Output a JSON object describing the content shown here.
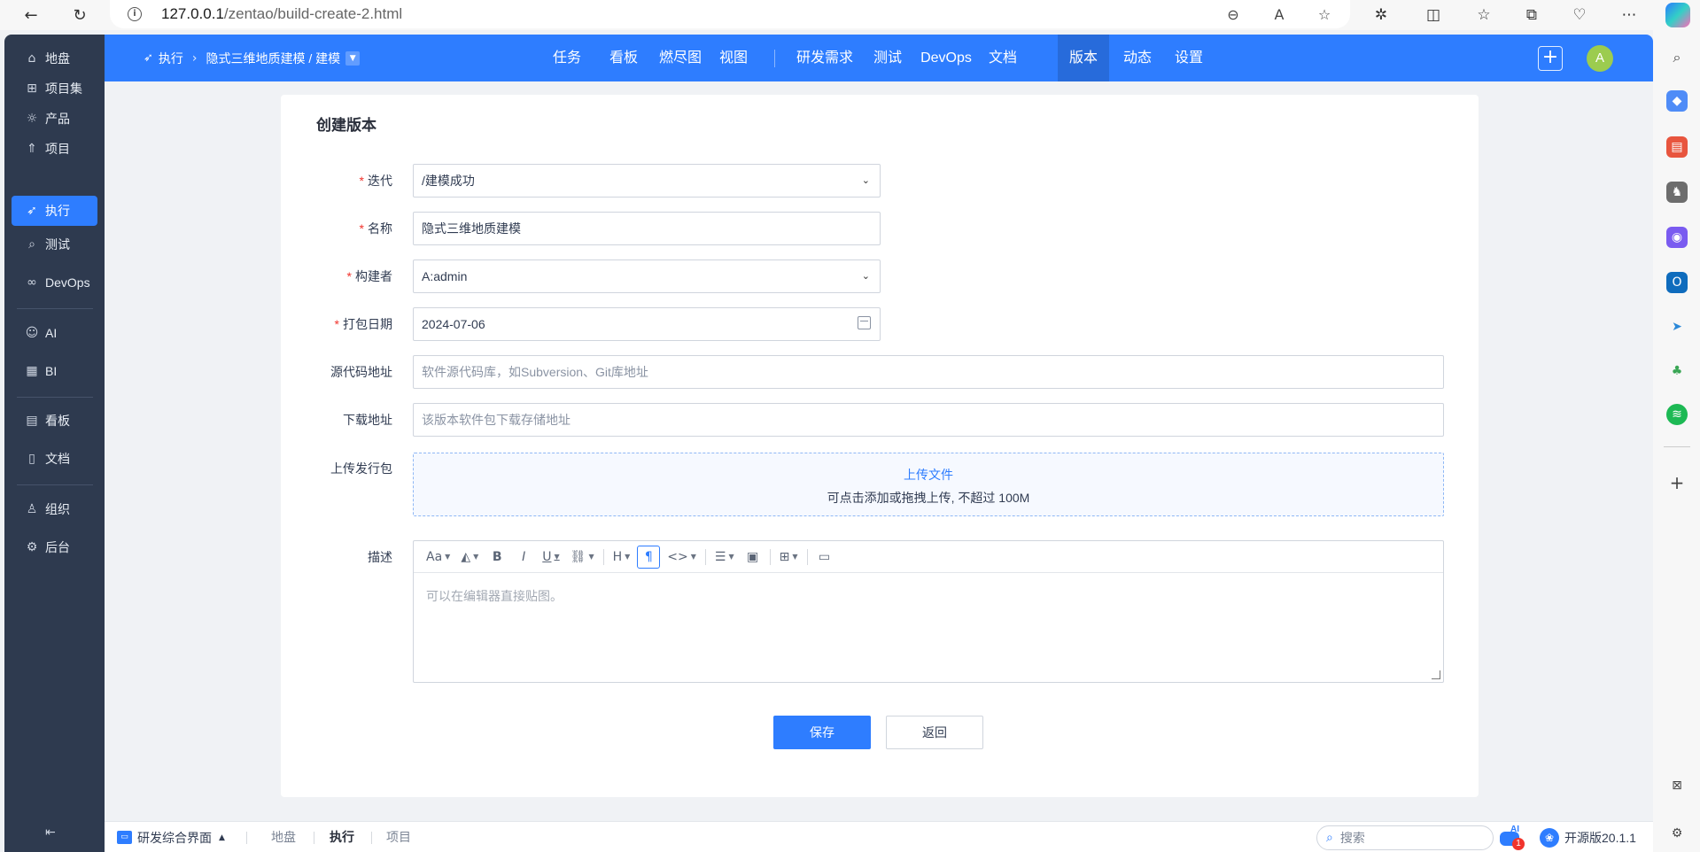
{
  "browser": {
    "url_host": "127.0.0.1",
    "url_path": "/zentao/build-create-2.html"
  },
  "left_nav": {
    "items": [
      {
        "label": "地盘",
        "icon": "home-icon"
      },
      {
        "label": "项目集",
        "icon": "grid-icon"
      },
      {
        "label": "产品",
        "icon": "bulb-icon"
      },
      {
        "label": "项目",
        "icon": "rocket-icon"
      },
      {
        "label": "执行",
        "icon": "send-icon"
      },
      {
        "label": "测试",
        "icon": "search-icon"
      },
      {
        "label": "DevOps",
        "icon": "infinity-icon"
      },
      {
        "label": "AI",
        "icon": "robot-icon"
      },
      {
        "label": "BI",
        "icon": "chart-icon"
      },
      {
        "label": "看板",
        "icon": "kanban-icon"
      },
      {
        "label": "文档",
        "icon": "doc-icon"
      },
      {
        "label": "组织",
        "icon": "people-icon"
      },
      {
        "label": "后台",
        "icon": "gear-icon"
      }
    ],
    "active_index": 4
  },
  "header": {
    "crumb_root": "执行",
    "crumb_current": "隐式三维地质建模 / 建模",
    "tabs": [
      "任务",
      "看板",
      "燃尽图",
      "视图",
      "研发需求",
      "测试",
      "DevOps",
      "文档",
      "版本",
      "动态",
      "设置"
    ],
    "active_tab": "版本",
    "plus_label": "+",
    "avatar_label": "A"
  },
  "form": {
    "title": "创建版本",
    "iteration_label": "迭代",
    "iteration_value": "/建模成功",
    "name_label": "名称",
    "name_value": "隐式三维地质建模",
    "builder_label": "构建者",
    "builder_value": "A:admin",
    "date_label": "打包日期",
    "date_value": "2024-07-06",
    "scm_label": "源代码地址",
    "scm_placeholder": "软件源代码库，如Subversion、Git库地址",
    "download_label": "下载地址",
    "download_placeholder": "该版本软件包下载存储地址",
    "upload_label": "上传发行包",
    "upload_link": "上传文件",
    "upload_hint": "可点击添加或拖拽上传, 不超过 100M",
    "desc_label": "描述",
    "desc_placeholder": "可以在编辑器直接贴图。",
    "required_mark": "*",
    "save_label": "保存",
    "back_label": "返回"
  },
  "editor_tools": [
    {
      "glyph": "Aa",
      "name": "font-size-icon",
      "caret": true
    },
    {
      "glyph": "◭",
      "name": "text-color-icon",
      "caret": true
    },
    {
      "glyph": "B",
      "name": "bold-icon",
      "caret": false
    },
    {
      "glyph": "I",
      "name": "italic-icon",
      "caret": false
    },
    {
      "glyph": "U",
      "name": "underline-icon",
      "caret": true
    },
    {
      "glyph": "⛓",
      "name": "link-icon",
      "caret": true
    },
    {
      "glyph": "H",
      "name": "heading-icon",
      "caret": true
    },
    {
      "glyph": "¶",
      "name": "paragraph-icon",
      "caret": false
    },
    {
      "glyph": "<>",
      "name": "code-icon",
      "caret": true
    },
    {
      "glyph": "☰",
      "name": "list-icon",
      "caret": true
    },
    {
      "glyph": "▣",
      "name": "image-icon",
      "caret": false
    },
    {
      "glyph": "⊞",
      "name": "table-icon",
      "caret": true
    },
    {
      "glyph": "▭",
      "name": "fullscreen-icon",
      "caret": false
    }
  ],
  "bottom": {
    "workspace": "研发综合界面",
    "crumbs": [
      "地盘",
      "执行",
      "项目"
    ],
    "active_crumb": "执行",
    "search_placeholder": "搜索",
    "ai_label": "AI",
    "ai_badge": "1",
    "edition": "开源版20.1.1"
  },
  "colors": {
    "primary": "#2e7dff",
    "nav_bg": "#2e3a4f",
    "required": "#f1342d"
  }
}
